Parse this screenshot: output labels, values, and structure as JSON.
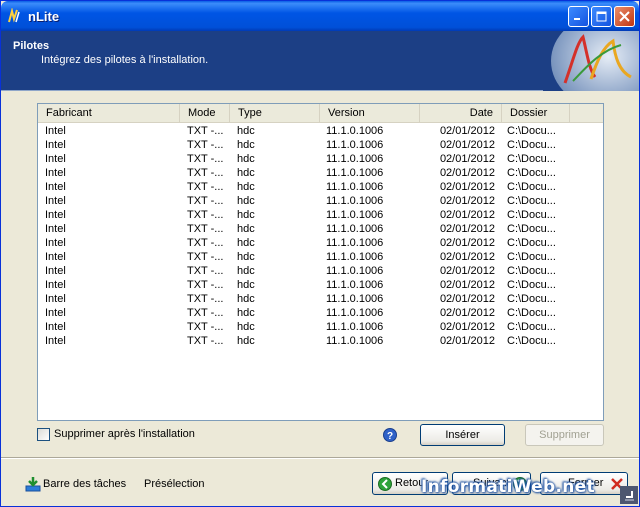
{
  "window": {
    "title": "nLite"
  },
  "header": {
    "title": "Pilotes",
    "subtitle": "Intégrez des pilotes à l'installation."
  },
  "list": {
    "columns": [
      "Fabricant",
      "Mode",
      "Type",
      "Version",
      "Date",
      "Dossier"
    ],
    "rows": [
      [
        "Intel",
        "TXT -...",
        "hdc",
        "11.1.0.1006",
        "02/01/2012",
        "C:\\Docu..."
      ],
      [
        "Intel",
        "TXT -...",
        "hdc",
        "11.1.0.1006",
        "02/01/2012",
        "C:\\Docu..."
      ],
      [
        "Intel",
        "TXT -...",
        "hdc",
        "11.1.0.1006",
        "02/01/2012",
        "C:\\Docu..."
      ],
      [
        "Intel",
        "TXT -...",
        "hdc",
        "11.1.0.1006",
        "02/01/2012",
        "C:\\Docu..."
      ],
      [
        "Intel",
        "TXT -...",
        "hdc",
        "11.1.0.1006",
        "02/01/2012",
        "C:\\Docu..."
      ],
      [
        "Intel",
        "TXT -...",
        "hdc",
        "11.1.0.1006",
        "02/01/2012",
        "C:\\Docu..."
      ],
      [
        "Intel",
        "TXT -...",
        "hdc",
        "11.1.0.1006",
        "02/01/2012",
        "C:\\Docu..."
      ],
      [
        "Intel",
        "TXT -...",
        "hdc",
        "11.1.0.1006",
        "02/01/2012",
        "C:\\Docu..."
      ],
      [
        "Intel",
        "TXT -...",
        "hdc",
        "11.1.0.1006",
        "02/01/2012",
        "C:\\Docu..."
      ],
      [
        "Intel",
        "TXT -...",
        "hdc",
        "11.1.0.1006",
        "02/01/2012",
        "C:\\Docu..."
      ],
      [
        "Intel",
        "TXT -...",
        "hdc",
        "11.1.0.1006",
        "02/01/2012",
        "C:\\Docu..."
      ],
      [
        "Intel",
        "TXT -...",
        "hdc",
        "11.1.0.1006",
        "02/01/2012",
        "C:\\Docu..."
      ],
      [
        "Intel",
        "TXT -...",
        "hdc",
        "11.1.0.1006",
        "02/01/2012",
        "C:\\Docu..."
      ],
      [
        "Intel",
        "TXT -...",
        "hdc",
        "11.1.0.1006",
        "02/01/2012",
        "C:\\Docu..."
      ],
      [
        "Intel",
        "TXT -...",
        "hdc",
        "11.1.0.1006",
        "02/01/2012",
        "C:\\Docu..."
      ],
      [
        "Intel",
        "TXT -...",
        "hdc",
        "11.1.0.1006",
        "02/01/2012",
        "C:\\Docu..."
      ]
    ]
  },
  "options": {
    "delete_after_install": "Supprimer après l'installation",
    "delete_after_install_checked": false
  },
  "actions": {
    "insert": "Insérer",
    "remove": "Supprimer"
  },
  "footer": {
    "taskbar": "Barre des tâches",
    "preset": "Présélection",
    "back": "Retour",
    "next": "Suivant",
    "close": "Fermer"
  },
  "watermark": "InformatiWeb.net",
  "colors": {
    "titlebar": "#0055e5",
    "header_bg": "#1c3f85",
    "dialog_bg": "#ece9d8"
  },
  "icons": [
    "nlite-icon",
    "minimize-icon",
    "maximize-icon",
    "close-icon",
    "nlite-logo",
    "help-icon",
    "taskbar-icon",
    "back-arrow-icon",
    "next-arrow-icon",
    "close-x-icon",
    "size-grip"
  ]
}
